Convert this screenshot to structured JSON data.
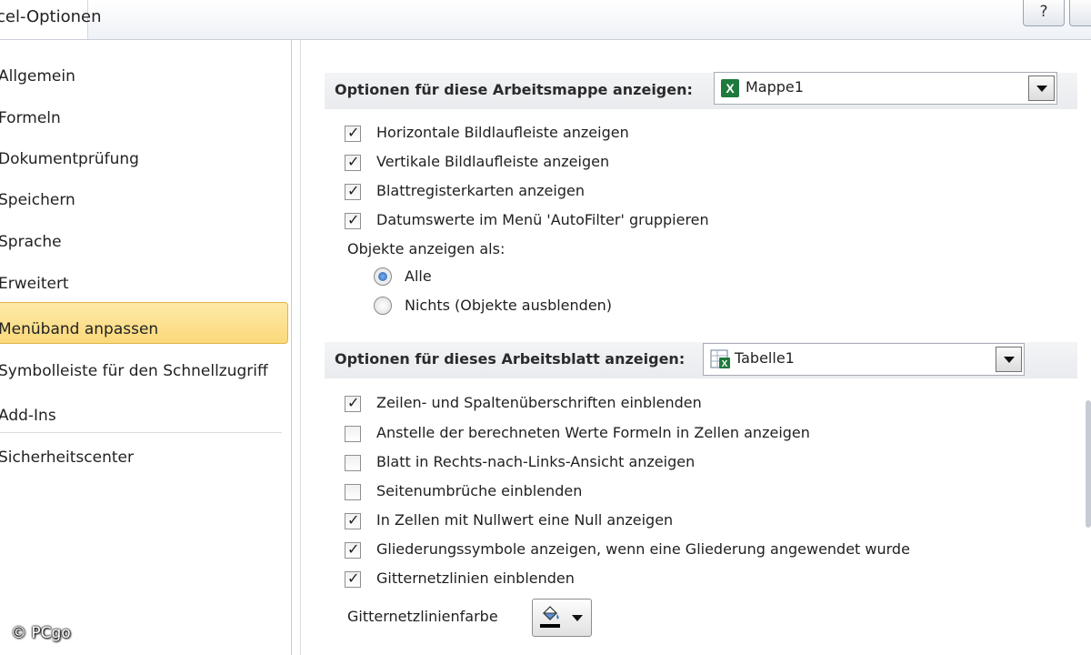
{
  "window": {
    "title": "cel-Optionen",
    "help_label": "?"
  },
  "nav": {
    "items": [
      "Allgemein",
      "Formeln",
      "Dokumentprüfung",
      "Speichern",
      "Sprache",
      "Erweitert",
      "Menüband anpassen",
      "Symbolleiste für den Schnellzugriff",
      "Add-Ins",
      "Sicherheitscenter"
    ],
    "selected": "Erweitert"
  },
  "workbook": {
    "header": "Optionen für diese Arbeitsmappe anzeigen:",
    "selected_workbook": "Mappe1",
    "options": [
      {
        "label": "Horizontale Bildlaufleiste anzeigen",
        "checked": true
      },
      {
        "label": "Vertikale Bildlaufleiste anzeigen",
        "checked": true
      },
      {
        "label": "Blattregisterkarten anzeigen",
        "checked": true
      },
      {
        "label": "Datumswerte im Menü 'AutoFilter' gruppieren",
        "checked": true
      }
    ],
    "objects_label": "Objekte anzeigen als:",
    "objects_options": [
      {
        "label": "Alle",
        "selected": true
      },
      {
        "label": "Nichts (Objekte ausblenden)",
        "selected": false
      }
    ]
  },
  "worksheet": {
    "header": "Optionen für dieses Arbeitsblatt anzeigen:",
    "selected_sheet": "Tabelle1",
    "options": [
      {
        "label": "Zeilen- und Spaltenüberschriften einblenden",
        "checked": true
      },
      {
        "label": "Anstelle der berechneten Werte Formeln in Zellen anzeigen",
        "checked": false
      },
      {
        "label": "Blatt in Rechts-nach-Links-Ansicht anzeigen",
        "checked": false
      },
      {
        "label": "Seitenumbrüche einblenden",
        "checked": false
      },
      {
        "label": "In Zellen mit Nullwert eine Null anzeigen",
        "checked": true
      },
      {
        "label": "Gliederungssymbole anzeigen, wenn eine Gliederung angewendet wurde",
        "checked": true
      },
      {
        "label": "Gitternetzlinien einblenden",
        "checked": true
      }
    ],
    "gridline_color_label": "Gitternetzlinienfarbe",
    "gridline_color": "#000000"
  },
  "watermark": "© PCgo",
  "colors": {
    "selection": "#fbd97a",
    "header_bg": "#eceef1",
    "radio_dot": "#1f5fb5"
  }
}
